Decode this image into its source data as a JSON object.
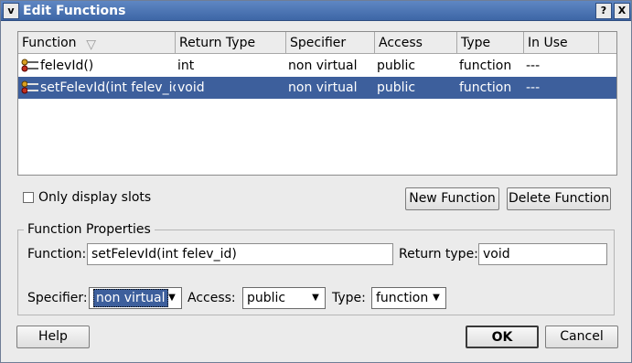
{
  "window": {
    "title": "Edit Functions",
    "menu_glyph": "v",
    "help_glyph": "?",
    "close_glyph": "X"
  },
  "list": {
    "columns": [
      "Function",
      "Return Type",
      "Specifier",
      "Access",
      "Type",
      "In Use"
    ],
    "sort_glyph": "▽",
    "rows": [
      {
        "function": "felevId()",
        "return_type": "int",
        "specifier": "non virtual",
        "access": "public",
        "type": "function",
        "in_use": "---",
        "selected": false
      },
      {
        "function": "setFelevId(int felev_id)",
        "return_type": "void",
        "specifier": "non virtual",
        "access": "public",
        "type": "function",
        "in_use": "---",
        "selected": true
      }
    ]
  },
  "only_slots": {
    "label": "Only display slots",
    "checked": false
  },
  "buttons": {
    "new_function": "New Function",
    "delete_function": "Delete Function",
    "help": "Help",
    "ok": "OK",
    "cancel": "Cancel"
  },
  "properties": {
    "group_title": "Function Properties",
    "function_label": "Function:",
    "function_value": "setFelevId(int felev_id)",
    "return_type_label": "Return type:",
    "return_type_value": "void",
    "specifier_label": "Specifier:",
    "specifier_value": "non virtual",
    "access_label": "Access:",
    "access_value": "public",
    "type_label": "Type:",
    "type_value": "function"
  },
  "colors": {
    "titlebar": "#3d66a6",
    "selection": "#3d5f9c"
  },
  "icons": {
    "row_icon": "function-slot-icon",
    "combo_arrow": "▼"
  }
}
